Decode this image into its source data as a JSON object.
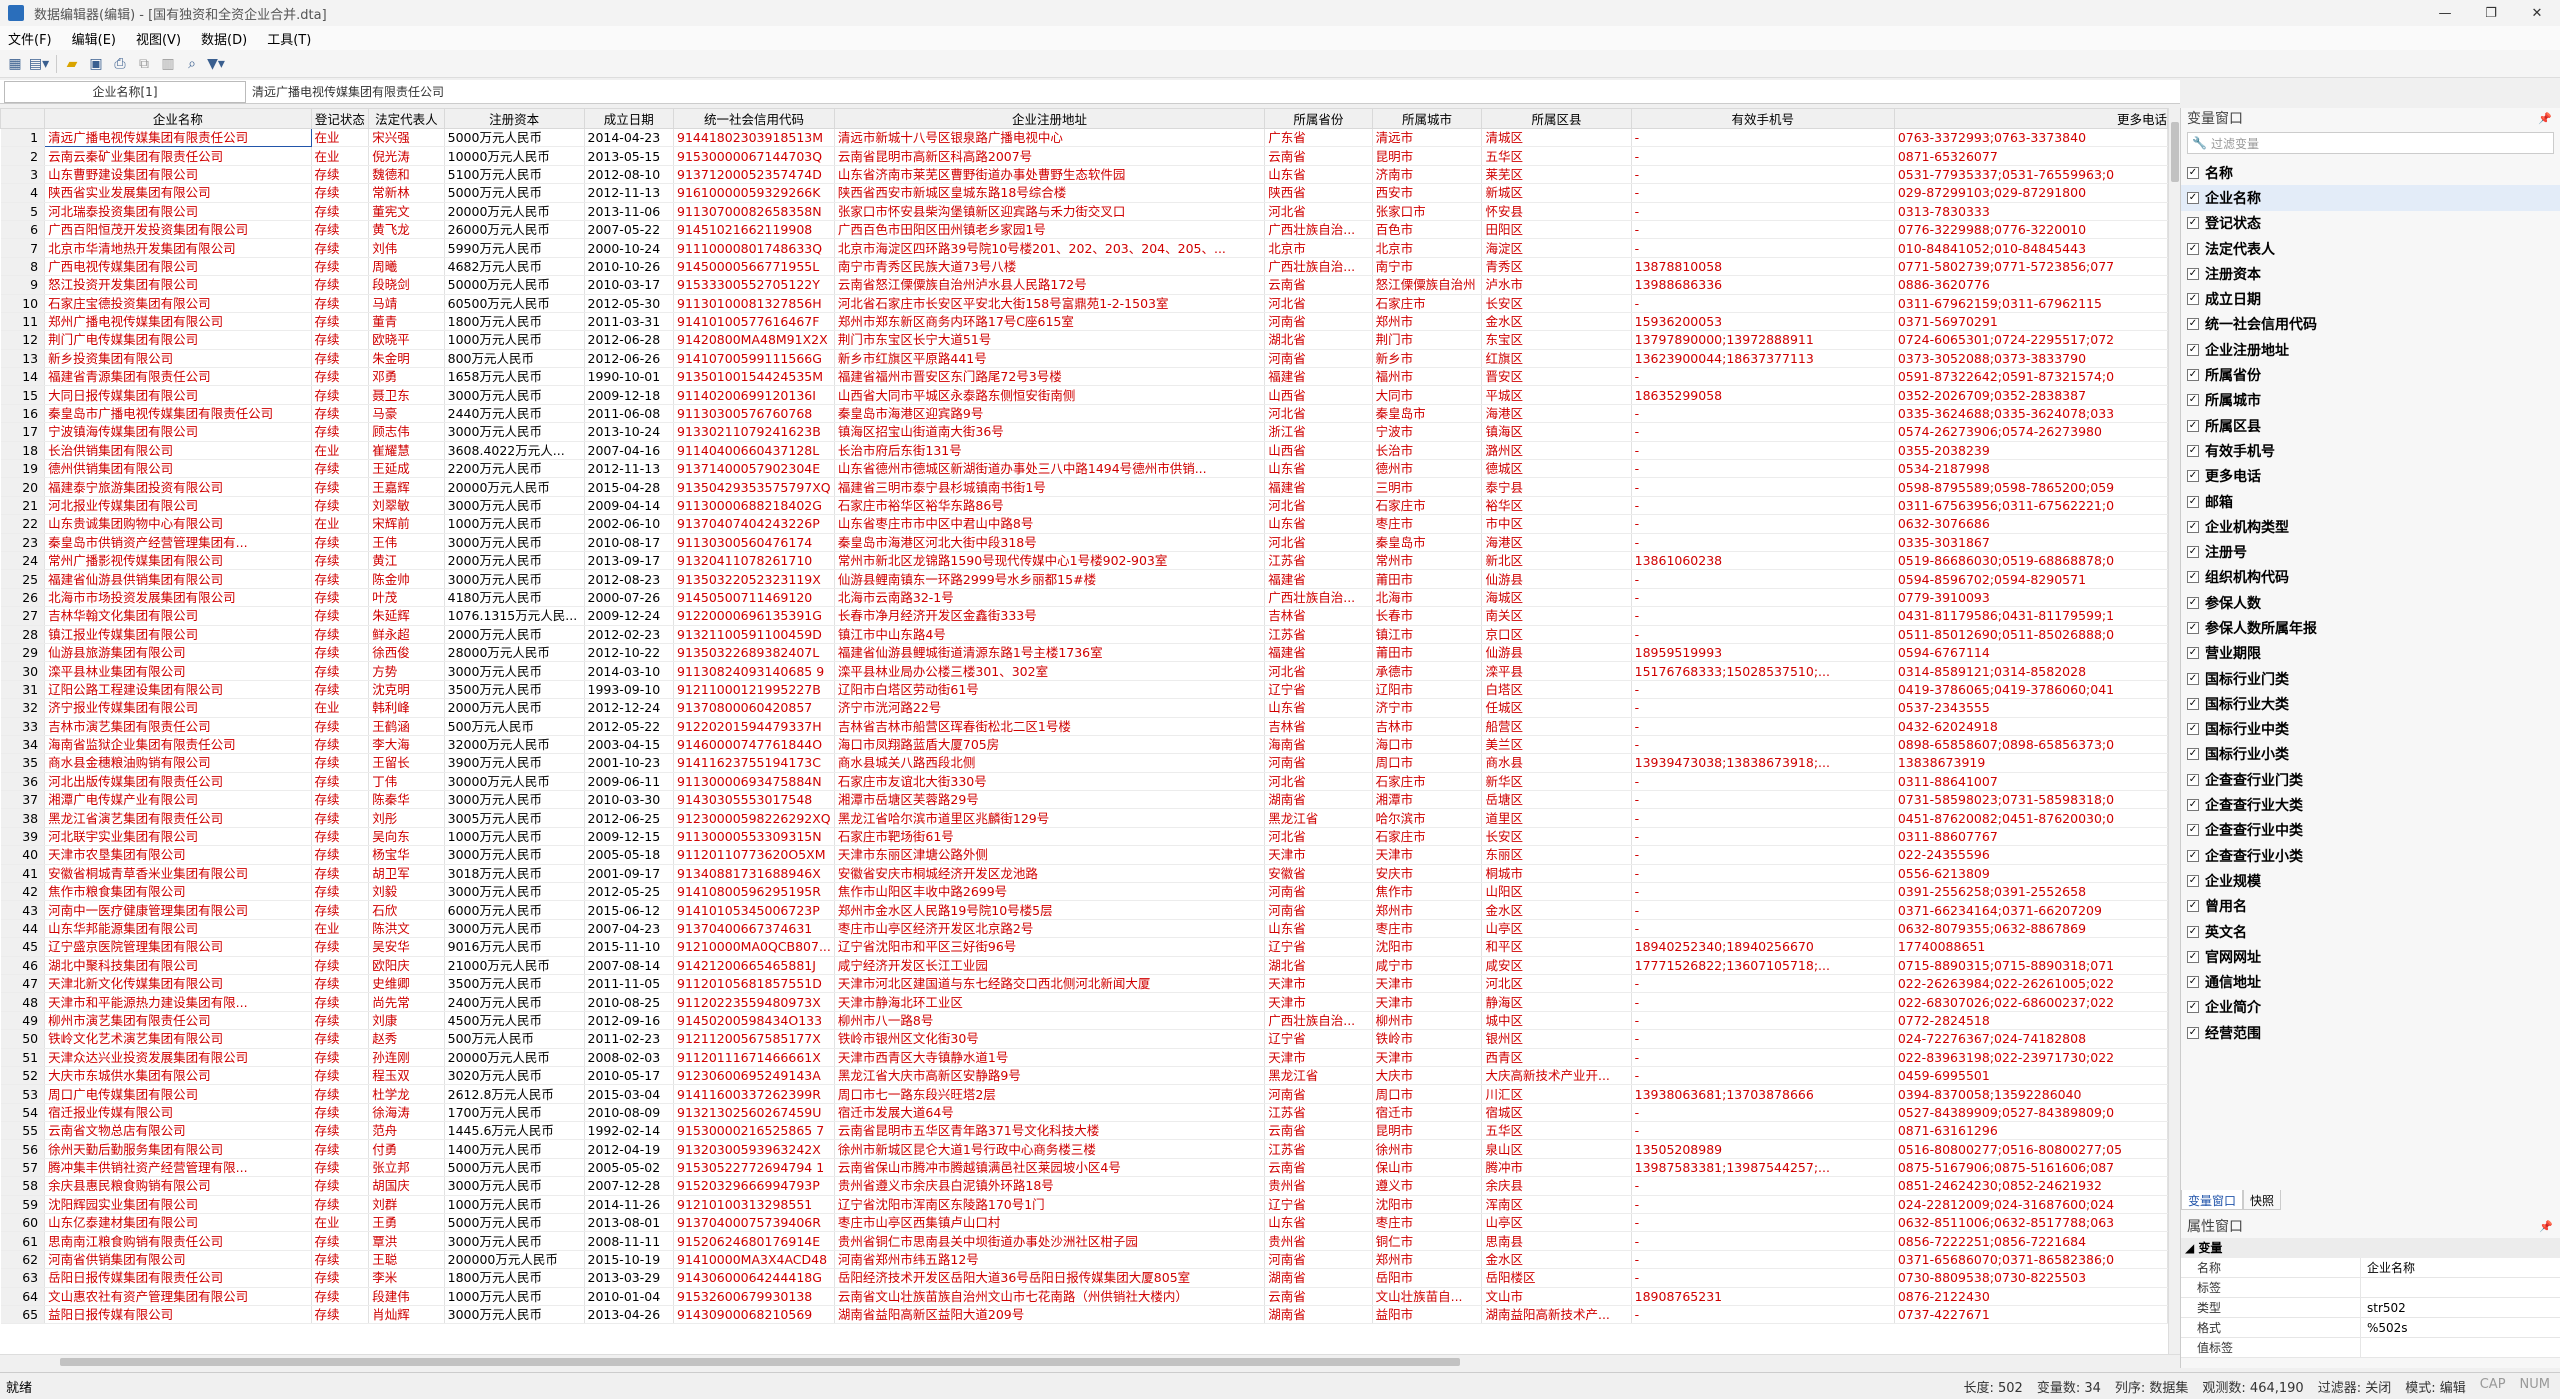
{
  "window": {
    "title": "数据编辑器(编辑) - [国有独资和全资企业合并.dta]"
  },
  "menu": [
    "文件(F)",
    "编辑(E)",
    "视图(V)",
    "数据(D)",
    "工具(T)"
  ],
  "cellbar": {
    "varname": "企业名称[1]",
    "value": "清远广播电视传媒集团有限责任公司"
  },
  "columns": [
    "企业名称",
    "登记状态",
    "法定代表人",
    "注册资本",
    "成立日期",
    "统一社会信用代码",
    "企业注册地址",
    "所属省份",
    "所属城市",
    "所属区县",
    "有效手机号",
    "更多电话"
  ],
  "rows": [
    [
      "1",
      "清远广播电视传媒集团有限责任公司",
      "在业",
      "宋兴强",
      "5000万元人民币",
      "2014-04-23",
      "91441802303918513M",
      "清远市新城十八号区银泉路广播电视中心",
      "广东省",
      "清远市",
      "清城区",
      "-",
      "0763-3372993;0763-3373840"
    ],
    [
      "2",
      "云南云秦矿业集团有限责任公司",
      "在业",
      "倪光涛",
      "10000万元人民币",
      "2013-05-15",
      "91530000067144703Q",
      "云南省昆明市高新区科高路2007号",
      "云南省",
      "昆明市",
      "五华区",
      "-",
      "0871-65326077"
    ],
    [
      "3",
      "山东曹野建设集团有限公司",
      "存续",
      "魏德和",
      "5100万元人民币",
      "2012-08-10",
      "91371200052357474D",
      "山东省济南市莱芜区曹野街道办事处曹野生态软件园",
      "山东省",
      "济南市",
      "莱芜区",
      "-",
      "0531-77935337;0531-76559963;0"
    ],
    [
      "4",
      "陕西省实业发展集团有限公司",
      "存续",
      "常新林",
      "5000万元人民币",
      "2012-11-13",
      "91610000059329266K",
      "陕西省西安市新城区皇城东路18号综合楼",
      "陕西省",
      "西安市",
      "新城区",
      "-",
      "029-87299103;029-87291800"
    ],
    [
      "5",
      "河北瑞泰投资集团有限公司",
      "存续",
      "董宪文",
      "20000万元人民币",
      "2013-11-06",
      "91130700082658358N",
      "张家口市怀安县柴沟堡镇新区迎宾路与禾力街交叉口",
      "河北省",
      "张家口市",
      "怀安县",
      "-",
      "0313-7830333"
    ],
    [
      "6",
      "广西百阳恒茂开发投资集团有限公司",
      "存续",
      "黄飞龙",
      "26000万元人民币",
      "2007-05-22",
      "91451021662119908",
      "广西百色市田阳区田州镇老乡家园1号",
      "广西壮族自治...",
      "百色市",
      "田阳区",
      "-",
      "0776-3229988;0776-3220010"
    ],
    [
      "7",
      "北京市华清地热开发集团有限公司",
      "存续",
      "刘伟",
      "5990万元人民币",
      "2000-10-24",
      "91110000801748633Q",
      "北京市海淀区四环路39号院10号楼201、202、203、204、205、...",
      "北京市",
      "北京市",
      "海淀区",
      "-",
      "010-84841052;010-84845443"
    ],
    [
      "8",
      "广西电视传媒集团有限公司",
      "存续",
      "周曦",
      "4682万元人民币",
      "2010-10-26",
      "91450000566771955L",
      "南宁市青秀区民族大道73号八楼",
      "广西壮族自治...",
      "南宁市",
      "青秀区",
      "13878810058",
      "0771-5802739;0771-5723856;077"
    ],
    [
      "9",
      "怒江投资开发集团有限公司",
      "存续",
      "段晓剑",
      "50000万元人民币",
      "2010-03-17",
      "91533300552705122Y",
      "云南省怒江傈僳族自治州泸水县人民路172号",
      "云南省",
      "怒江傈僳族自治州",
      "泸水市",
      "13988686336",
      "0886-3620776"
    ],
    [
      "10",
      "石家庄宝德投资集团有限公司",
      "存续",
      "马靖",
      "60500万元人民币",
      "2012-05-30",
      "91130100081327856H",
      "河北省石家庄市长安区平安北大街158号富鼎苑1-2-1503室",
      "河北省",
      "石家庄市",
      "长安区",
      "-",
      "0311-67962159;0311-67962115"
    ],
    [
      "11",
      "郑州广播电视传媒集团有限公司",
      "存续",
      "董青",
      "1800万元人民币",
      "2011-03-31",
      "91410100577616467F",
      "郑州市郑东新区商务内环路17号C座615室",
      "河南省",
      "郑州市",
      "金水区",
      "15936200053",
      "0371-56970291"
    ],
    [
      "12",
      "荆门广电传媒集团有限公司",
      "存续",
      "欧晓平",
      "1000万元人民币",
      "2012-06-28",
      "91420800MA48M91X2X",
      "荆门市东宝区长宁大道51号",
      "湖北省",
      "荆门市",
      "东宝区",
      "13797890000;13972888911",
      "0724-6065301;0724-2295517;072"
    ],
    [
      "13",
      "新乡投资集团有限公司",
      "存续",
      "朱金明",
      "800万元人民币",
      "2012-06-26",
      "91410700599111566G",
      "新乡市红旗区平原路441号",
      "河南省",
      "新乡市",
      "红旗区",
      "13623900044;18637377113",
      "0373-3052088;0373-3833790"
    ],
    [
      "14",
      "福建省青源集团有限责任公司",
      "存续",
      "邓勇",
      "1658万元人民币",
      "1990-10-01",
      "91350100154424535M",
      "福建省福州市晋安区东门路尾72号3号楼",
      "福建省",
      "福州市",
      "晋安区",
      "-",
      "0591-87322642;0591-87321574;0"
    ],
    [
      "15",
      "大同日报传媒集团有限公司",
      "存续",
      "聂卫东",
      "3000万元人民币",
      "2009-12-18",
      "91140200699120136I",
      "山西省大同市平城区永泰路东侧恒安街南侧",
      "山西省",
      "大同市",
      "平城区",
      "18635299058",
      "0352-2026709;0352-2838387"
    ],
    [
      "16",
      "秦皇岛市广播电视传媒集团有限责任公司",
      "存续",
      "马豪",
      "2440万元人民币",
      "2011-06-08",
      "91130300576760768",
      "秦皇岛市海港区迎宾路9号",
      "河北省",
      "秦皇岛市",
      "海港区",
      "-",
      "0335-3624688;0335-3624078;033"
    ],
    [
      "17",
      "宁波镇海传媒集团有限公司",
      "存续",
      "顾志伟",
      "3000万元人民币",
      "2013-10-24",
      "91330211079241623B",
      "镇海区招宝山街道南大街36号",
      "浙江省",
      "宁波市",
      "镇海区",
      "-",
      "0574-26273906;0574-26273980"
    ],
    [
      "18",
      "长治供销集团有限公司",
      "在业",
      "崔耀慧",
      "3608.4022万元人...",
      "2007-04-16",
      "91140400660437128L",
      "长治市府后东街131号",
      "山西省",
      "长治市",
      "潞州区",
      "-",
      "0355-2038239"
    ],
    [
      "19",
      "德州供销集团有限公司",
      "存续",
      "王延成",
      "2200万元人民币",
      "2012-11-13",
      "91371400057902304E",
      "山东省德州市德城区新湖街道办事处三八中路1494号德州市供销...",
      "山东省",
      "德州市",
      "德城区",
      "-",
      "0534-2187998"
    ],
    [
      "20",
      "福建泰宁旅游集团投资有限公司",
      "存续",
      "王嘉辉",
      "20000万元人民币",
      "2015-04-28",
      "91350429353575797XQ",
      "福建省三明市泰宁县杉城镇南书街1号",
      "福建省",
      "三明市",
      "泰宁县",
      "-",
      "0598-8795589;0598-7865200;059"
    ],
    [
      "21",
      "河北报业传媒集团有限公司",
      "存续",
      "刘翠敏",
      "3000万元人民币",
      "2009-04-14",
      "91130000688218402G",
      "石家庄市裕华区裕华东路86号",
      "河北省",
      "石家庄市",
      "裕华区",
      "-",
      "0311-67563956;0311-67562221;0"
    ],
    [
      "22",
      "山东贵诚集团购物中心有限公司",
      "在业",
      "宋辉前",
      "1000万元人民币",
      "2002-06-10",
      "91370407404243226P",
      "山东省枣庄市市中区中君山中路8号",
      "山东省",
      "枣庄市",
      "市中区",
      "-",
      "0632-3076686"
    ],
    [
      "23",
      "秦皇岛市供销资产经营管理集团有...",
      "存续",
      "王伟",
      "3000万元人民币",
      "2010-08-17",
      "91130300560476174",
      "秦皇岛市海港区河北大街中段318号",
      "河北省",
      "秦皇岛市",
      "海港区",
      "-",
      "0335-3031867"
    ],
    [
      "24",
      "常州广播影视传媒集团有限公司",
      "存续",
      "黄江",
      "2000万元人民币",
      "2013-09-17",
      "91320411078261710",
      "常州市新北区龙锦路1590号现代传媒中心1号楼902-903室",
      "江苏省",
      "常州市",
      "新北区",
      "13861060238",
      "0519-86686030;0519-68868878;0"
    ],
    [
      "25",
      "福建省仙游县供销集团有限公司",
      "存续",
      "陈金帅",
      "3000万元人民币",
      "2012-08-23",
      "91350322052323119X",
      "仙游县鲤南镇东一环路2999号水乡丽都15#楼",
      "福建省",
      "莆田市",
      "仙游县",
      "-",
      "0594-8596702;0594-8290571"
    ],
    [
      "26",
      "北海市市场投资发展集团有限公司",
      "存续",
      "叶茂",
      "4180万元人民币",
      "2000-07-26",
      "91450500711469120",
      "北海市云南路32-1号",
      "广西壮族自治...",
      "北海市",
      "海城区",
      "-",
      "0779-3910093"
    ],
    [
      "27",
      "吉林华翰文化集团有限公司",
      "存续",
      "朱延辉",
      "1076.1315万元人民...",
      "2009-12-24",
      "91220000696135391G",
      "长春市净月经济开发区金鑫街333号",
      "吉林省",
      "长春市",
      "南关区",
      "-",
      "0431-81179586;0431-81179599;1"
    ],
    [
      "28",
      "镇江报业传媒集团有限公司",
      "存续",
      "鲜永超",
      "2000万元人民币",
      "2012-02-23",
      "91321100591100459D",
      "镇江市中山东路4号",
      "江苏省",
      "镇江市",
      "京口区",
      "-",
      "0511-85012690;0511-85026888;0"
    ],
    [
      "29",
      "仙游县旅游集团有限公司",
      "存续",
      "徐西俊",
      "28000万元人民币",
      "2012-10-22",
      "91350322689382407L",
      "福建省仙游县鲤城街道清源东路1号主楼1736室",
      "福建省",
      "莆田市",
      "仙游县",
      "18959519993",
      "0594-6767114"
    ],
    [
      "30",
      "滦平县林业集团有限公司",
      "存续",
      "方势",
      "3000万元人民币",
      "2014-03-10",
      "91130824093140685 9",
      "滦平县林业局办公楼三楼301、302室",
      "河北省",
      "承德市",
      "滦平县",
      "15176768333;15028537510;...",
      "0314-8589121;0314-8582028"
    ],
    [
      "31",
      "辽阳公路工程建设集团有限公司",
      "存续",
      "沈克明",
      "3500万元人民币",
      "1993-09-10",
      "91211000121995227B",
      "辽阳市白塔区劳动街61号",
      "辽宁省",
      "辽阳市",
      "白塔区",
      "-",
      "0419-3786065;0419-3786060;041"
    ],
    [
      "32",
      "济宁报业传媒集团有限公司",
      "在业",
      "韩利峰",
      "2000万元人民币",
      "2012-12-24",
      "91370800060420857",
      "济宁市洸河路22号",
      "山东省",
      "济宁市",
      "任城区",
      "-",
      "0537-2343555"
    ],
    [
      "33",
      "吉林市演艺集团有限责任公司",
      "存续",
      "王鹤涵",
      "500万元人民币",
      "2012-05-22",
      "91220201594479337H",
      "吉林省吉林市船营区珲春街松北二区1号楼",
      "吉林省",
      "吉林市",
      "船营区",
      "-",
      "0432-62024918"
    ],
    [
      "34",
      "海南省监狱企业集团有限责任公司",
      "存续",
      "李大海",
      "32000万元人民币",
      "2003-04-15",
      "91460000747761844O",
      "海口市凤翔路蓝盾大厦705房",
      "海南省",
      "海口市",
      "美兰区",
      "-",
      "0898-65858607;0898-65856373;0"
    ],
    [
      "35",
      "商水县金穗粮油购销有限公司",
      "存续",
      "王留长",
      "3900万元人民币",
      "2001-10-23",
      "91411623755194173C",
      "商水县城关八路西段北侧",
      "河南省",
      "周口市",
      "商水县",
      "13939473038;13838673918;...",
      "13838673919"
    ],
    [
      "36",
      "河北出版传媒集团有限责任公司",
      "存续",
      "丁伟",
      "30000万元人民币",
      "2009-06-11",
      "91130000693475884N",
      "石家庄市友谊北大街330号",
      "河北省",
      "石家庄市",
      "新华区",
      "-",
      "0311-88641007"
    ],
    [
      "37",
      "湘潭广电传媒产业有限公司",
      "存续",
      "陈秦华",
      "3000万元人民币",
      "2010-03-30",
      "91430305553017548",
      "湘潭市岳塘区芙蓉路29号",
      "湖南省",
      "湘潭市",
      "岳塘区",
      "-",
      "0731-58598023;0731-58598318;0"
    ],
    [
      "38",
      "黑龙江省演艺集团有限责任公司",
      "存续",
      "刘彤",
      "3005万元人民币",
      "2012-06-25",
      "91230000598226292XQ",
      "黑龙江省哈尔滨市道里区兆麟街129号",
      "黑龙江省",
      "哈尔滨市",
      "道里区",
      "-",
      "0451-87620082;0451-87620030;0"
    ],
    [
      "39",
      "河北联宇实业集团有限公司",
      "存续",
      "吴向东",
      "1000万元人民币",
      "2009-12-15",
      "91130000553309315N",
      "石家庄市靶场街61号",
      "河北省",
      "石家庄市",
      "长安区",
      "-",
      "0311-88607767"
    ],
    [
      "40",
      "天津市农垦集团有限公司",
      "存续",
      "杨宝华",
      "3000万元人民币",
      "2005-05-18",
      "91120110773620O5XM",
      "天津市东丽区津塘公路外侧",
      "天津市",
      "天津市",
      "东丽区",
      "-",
      "022-24355596"
    ],
    [
      "41",
      "安徽省桐城青草香米业集团有限公司",
      "存续",
      "胡卫军",
      "3018万元人民币",
      "2001-09-17",
      "91340881731688946X",
      "安徽省安庆市桐城经济开发区龙池路",
      "安徽省",
      "安庆市",
      "桐城市",
      "-",
      "0556-6213809"
    ],
    [
      "42",
      "焦作市粮食集团有限公司",
      "存续",
      "刘毅",
      "3000万元人民币",
      "2012-05-25",
      "91410800596295195R",
      "焦作市山阳区丰收中路2699号",
      "河南省",
      "焦作市",
      "山阳区",
      "-",
      "0391-2556258;0391-2552658"
    ],
    [
      "43",
      "河南中一医疗健康管理集团有限公司",
      "存续",
      "石欣",
      "6000万元人民币",
      "2015-06-12",
      "91410105345006723P",
      "郑州市金水区人民路19号院10号楼5层",
      "河南省",
      "郑州市",
      "金水区",
      "-",
      "0371-66234164;0371-66207209"
    ],
    [
      "44",
      "山东华邦能源集团有限公司",
      "在业",
      "陈洪文",
      "3000万元人民币",
      "2007-04-23",
      "91370400667374631",
      "枣庄市山亭区经济开发区北京路2号",
      "山东省",
      "枣庄市",
      "山亭区",
      "-",
      "0632-8079355;0632-8867869"
    ],
    [
      "45",
      "辽宁盛京医院管理集团有限公司",
      "存续",
      "吴安华",
      "9016万元人民币",
      "2015-11-10",
      "91210000MA0QCB807...",
      "辽宁省沈阳市和平区三好街96号",
      "辽宁省",
      "沈阳市",
      "和平区",
      "18940252340;18940256670",
      "17740088651"
    ],
    [
      "46",
      "湖北中聚科技集团有限公司",
      "存续",
      "欧阳庆",
      "21000万元人民币",
      "2007-08-14",
      "91421200665465881J",
      "咸宁经济开发区长江工业园",
      "湖北省",
      "咸宁市",
      "咸安区",
      "17771526822;13607105718;...",
      "0715-8890315;0715-8890318;071"
    ],
    [
      "47",
      "天津北新文化传媒集团有限公司",
      "存续",
      "史维卿",
      "3500万元人民币",
      "2011-11-05",
      "91120105681857551D",
      "天津市河北区建国道与东七经路交口西北侧河北新闻大厦",
      "天津市",
      "天津市",
      "河北区",
      "-",
      "022-26263984;022-26261005;022"
    ],
    [
      "48",
      "天津市和平能源热力建设集团有限...",
      "存续",
      "尚先常",
      "2400万元人民币",
      "2010-08-25",
      "91120223559480973X",
      "天津市静海北环工业区",
      "天津市",
      "天津市",
      "静海区",
      "-",
      "022-68307026;022-68600237;022"
    ],
    [
      "49",
      "柳州市演艺集团有限责任公司",
      "存续",
      "刘康",
      "4500万元人民币",
      "2012-09-16",
      "91450200598434O133",
      "柳州市八一路8号",
      "广西壮族自治...",
      "柳州市",
      "城中区",
      "-",
      "0772-2824518"
    ],
    [
      "50",
      "铁岭文化艺术演艺集团有限公司",
      "存续",
      "赵秀",
      "500万元人民币",
      "2011-02-23",
      "91211200567585177X",
      "铁岭市银州区文化街30号",
      "辽宁省",
      "铁岭市",
      "银州区",
      "-",
      "024-72276367;024-74182808"
    ],
    [
      "51",
      "天津众达兴业投资发展集团有限公司",
      "存续",
      "孙连刚",
      "20000万元人民币",
      "2008-02-03",
      "91120111671466661X",
      "天津市西青区大寺镇静水道1号",
      "天津市",
      "天津市",
      "西青区",
      "-",
      "022-83963198;022-23971730;022"
    ],
    [
      "52",
      "大庆市东城供水集团有限公司",
      "存续",
      "程玉双",
      "3020万元人民币",
      "2010-05-17",
      "91230600695249143A",
      "黑龙江省大庆市高新区安静路9号",
      "黑龙江省",
      "大庆市",
      "大庆高新技术产业开...",
      "-",
      "0459-6995501"
    ],
    [
      "53",
      "周口广电传媒集团有限公司",
      "存续",
      "杜学龙",
      "2612.8万元人民币",
      "2015-03-04",
      "91411600337262399R",
      "周口市七一路东段兴旺塔2层",
      "河南省",
      "周口市",
      "川汇区",
      "13938063681;13703878666",
      "0394-8370058;13592286040"
    ],
    [
      "54",
      "宿迁报业传媒有限公司",
      "存续",
      "徐海涛",
      "1700万元人民币",
      "2010-08-09",
      "91321302560267459U",
      "宿迁市发展大道64号",
      "江苏省",
      "宿迁市",
      "宿城区",
      "-",
      "0527-84389909;0527-84389809;0"
    ],
    [
      "55",
      "云南省文物总店有限公司",
      "存续",
      "范舟",
      "1445.6万元人民币",
      "1992-02-14",
      "91530000216525865 7",
      "云南省昆明市五华区青年路371号文化科技大楼",
      "云南省",
      "昆明市",
      "五华区",
      "-",
      "0871-63161296"
    ],
    [
      "56",
      "徐州天勤后勤服务集团有限公司",
      "存续",
      "付勇",
      "1400万元人民币",
      "2012-04-19",
      "91320300593963242X",
      "徐州市新城区昆仑大道1号行政中心商务楼三楼",
      "江苏省",
      "徐州市",
      "泉山区",
      "13505208989",
      "0516-80800277;0516-80800277;05"
    ],
    [
      "57",
      "腾冲集丰供销社资产经营管理有限...",
      "存续",
      "张立邦",
      "5000万元人民币",
      "2005-05-02",
      "91530522772694794 1",
      "云南省保山市腾冲市腾越镇满邑社区莱园坡小区4号",
      "云南省",
      "保山市",
      "腾冲市",
      "13987583381;13987544257;...",
      "0875-5167906;0875-5161606;087"
    ],
    [
      "58",
      "余庆县惠民粮食购销有限公司",
      "存续",
      "胡国庆",
      "3000万元人民币",
      "2007-12-28",
      "91520329666994793P",
      "贵州省遵义市余庆县白泥镇外环路18号",
      "贵州省",
      "遵义市",
      "余庆县",
      "-",
      "0851-24624230;0852-24621932"
    ],
    [
      "59",
      "沈阳辉园实业集团有限公司",
      "存续",
      "刘群",
      "1000万元人民币",
      "2014-11-26",
      "91210100313298551",
      "辽宁省沈阳市浑南区东陵路170号1门",
      "辽宁省",
      "沈阳市",
      "浑南区",
      "-",
      "024-22812009;024-31687600;024"
    ],
    [
      "60",
      "山东亿泰建材集团有限公司",
      "在业",
      "王勇",
      "5000万元人民币",
      "2013-08-01",
      "91370400075739406R",
      "枣庄市山亭区西集镇卢山口村",
      "山东省",
      "枣庄市",
      "山亭区",
      "-",
      "0632-8511006;0632-8517788;063"
    ],
    [
      "61",
      "思南南江粮食购销有限责任公司",
      "存续",
      "覃洪",
      "3000万元人民币",
      "2008-11-11",
      "91520624680176914E",
      "贵州省铜仁市思南县关中坝街道办事处沙洲社区柑子园",
      "贵州省",
      "铜仁市",
      "思南县",
      "-",
      "0856-7222251;0856-7221684"
    ],
    [
      "62",
      "河南省供销集团有限公司",
      "存续",
      "王聪",
      "200000万元人民币",
      "2015-10-19",
      "91410000MA3X4ACD48",
      "河南省郑州市纬五路12号",
      "河南省",
      "郑州市",
      "金水区",
      "-",
      "0371-65686070;0371-86582386;0"
    ],
    [
      "63",
      "岳阳日报传媒集团有限责任公司",
      "存续",
      "李米",
      "1800万元人民币",
      "2013-03-29",
      "91430600064244418G",
      "岳阳经济技术开发区岳阳大道36号岳阳日报传媒集团大厦805室",
      "湖南省",
      "岳阳市",
      "岳阳楼区",
      "-",
      "0730-8809538;0730-8225503"
    ],
    [
      "64",
      "文山惠农社有资产管理集团有限公司",
      "存续",
      "段建伟",
      "1000万元人民币",
      "2010-01-04",
      "91532600679930138",
      "云南省文山壮族苗族自治州文山市七花南路（州供销社大楼内）",
      "云南省",
      "文山壮族苗自...",
      "文山市",
      "18908765231",
      "0876-2122430"
    ],
    [
      "65",
      "益阳日报传媒有限公司",
      "存续",
      "肖灿辉",
      "3000万元人民币",
      "2013-04-26",
      "91430900068210569",
      "湖南省益阳高新区益阳大道209号",
      "湖南省",
      "益阳市",
      "湖南益阳高新技术产...",
      "-",
      "0737-4227671"
    ]
  ],
  "varpanel": {
    "title": "变量窗口",
    "filter_placeholder": "过滤变量",
    "header": "名称",
    "items": [
      "企业名称",
      "登记状态",
      "法定代表人",
      "注册资本",
      "成立日期",
      "统一社会信用代码",
      "企业注册地址",
      "所属省份",
      "所属城市",
      "所属区县",
      "有效手机号",
      "更多电话",
      "邮箱",
      "企业机构类型",
      "注册号",
      "组织机构代码",
      "参保人数",
      "参保人数所属年报",
      "营业期限",
      "国标行业门类",
      "国标行业大类",
      "国标行业中类",
      "国标行业小类",
      "企查查行业门类",
      "企查查行业大类",
      "企查查行业中类",
      "企查查行业小类",
      "企业规模",
      "曾用名",
      "英文名",
      "官网网址",
      "通信地址",
      "企业简介",
      "经营范围"
    ]
  },
  "ptabs": [
    "变量窗口",
    "快照"
  ],
  "props": {
    "title": "属性窗口",
    "group": "变量",
    "rows": [
      [
        "名称",
        "企业名称"
      ],
      [
        "标签",
        ""
      ],
      [
        "类型",
        "str502"
      ],
      [
        "格式",
        "%502s"
      ],
      [
        "值标签",
        ""
      ]
    ]
  },
  "status": {
    "left": "就绪",
    "items": [
      "长度: 502",
      "变量数: 34",
      "列序: 数据集",
      "观测数: 464,190",
      "过滤器: 关闭",
      "模式: 编辑",
      "CAP",
      "NUM"
    ]
  }
}
